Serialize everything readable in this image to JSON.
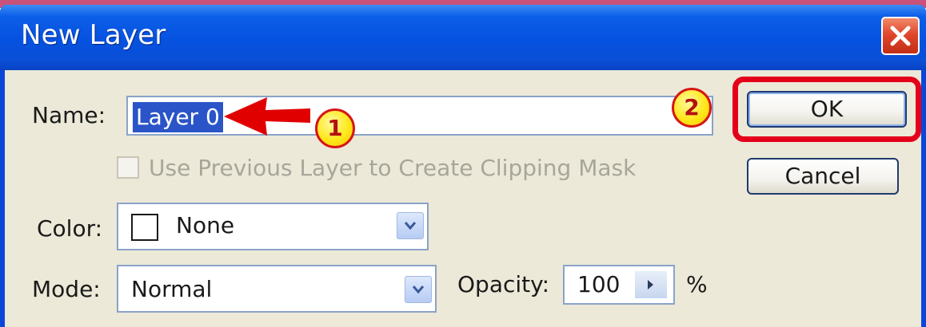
{
  "dialog": {
    "title": "New Layer",
    "close_glyph": "✕",
    "name_label": "Name:",
    "name_value": "Layer 0",
    "clipping_checkbox_label": "Use Previous Layer to Create Clipping Mask",
    "clipping_checkbox_checked": false,
    "clipping_checkbox_enabled": false,
    "color_label": "Color:",
    "color_value": "None",
    "mode_label": "Mode:",
    "mode_value": "Normal",
    "opacity_label": "Opacity:",
    "opacity_value": "100",
    "opacity_unit": "%",
    "ok_label": "OK",
    "cancel_label": "Cancel"
  },
  "annotations": {
    "step1": "1",
    "step2": "2",
    "highlight_color": "#e4001a",
    "marker_fill": "#ffe81a"
  },
  "icons": {
    "close": "close-x-icon",
    "dropdown": "chevron-down-icon",
    "spin": "chevron-right-icon",
    "arrow": "red-arrow-left-icon"
  },
  "colors": {
    "titlebar": "#0652e0",
    "client": "#ece9d8",
    "selection": "#2a54c8"
  }
}
